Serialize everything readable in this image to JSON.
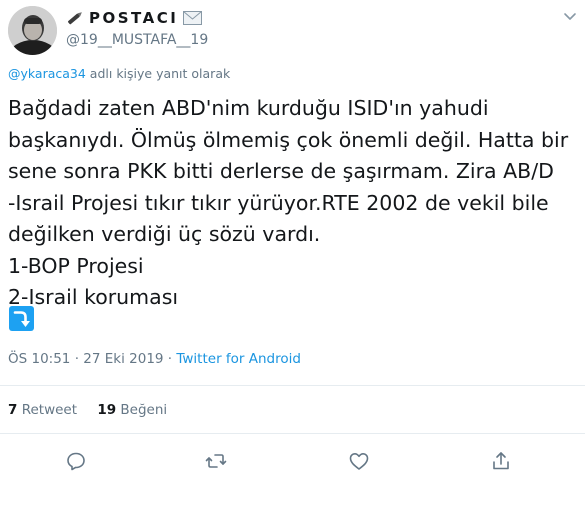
{
  "author": {
    "display_name": "POSTACI",
    "handle": "@19__MUSTAFA__19",
    "name_prefix_icon": "pen-icon",
    "name_suffix_icon": "envelope-icon"
  },
  "reply_to": {
    "handle": "@ykaraca34",
    "suffix": " adlı kişiye yanıt olarak"
  },
  "tweet": {
    "lines": [
      "Bağdadi zaten ABD'nim kurduğu ISID'ın yahudi",
      "başkanıydı. Ölmüş ölmemiş çok önemli değil. Hatta bir",
      "sene sonra PKK bitti derlerse de şaşırmam. Zira AB/D",
      "-Israil Projesi tıkır tıkır yürüyor.RTE 2002 de vekil bile",
      "değilken verdiği üç sözü vardı.",
      "1-BOP Projesi",
      "2-Israil koruması"
    ],
    "emoji": "right-arrow-curving-down-icon"
  },
  "meta": {
    "time": "ÖS 10:51",
    "separator": " · ",
    "date": "27 Eki 2019",
    "source": "Twitter for Android"
  },
  "stats": {
    "retweets_count": "7",
    "retweets_label": "Retweet",
    "likes_count": "19",
    "likes_label": "Beğeni"
  },
  "colors": {
    "link": "#1b95e0",
    "muted": "#657786",
    "text": "#14171a",
    "divider": "#e6ecf0",
    "emoji_bg": "#1da1f2"
  }
}
